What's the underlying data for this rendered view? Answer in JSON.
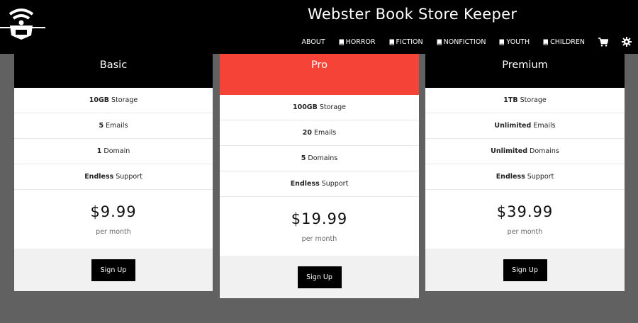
{
  "header": {
    "title": "Webster Book Store Keeper",
    "nav": [
      {
        "label": "ABOUT",
        "icon": ""
      },
      {
        "label": "HORROR",
        "icon": "book-icon"
      },
      {
        "label": "FICTION",
        "icon": "book-icon"
      },
      {
        "label": "NONFICTION",
        "icon": "book-icon"
      },
      {
        "label": "YOUTH",
        "icon": "book-icon"
      },
      {
        "label": "CHILDREN",
        "icon": "book-icon"
      }
    ],
    "icons": [
      "cart-icon",
      "gear-icon"
    ]
  },
  "plans": [
    {
      "name": "Basic",
      "features": [
        {
          "bold": "10GB",
          "text": "Storage"
        },
        {
          "bold": "5",
          "text": "Emails"
        },
        {
          "bold": "1",
          "text": "Domain"
        },
        {
          "bold": "Endless",
          "text": "Support"
        }
      ],
      "price": "$9.99",
      "period": "per month",
      "button": "Sign Up"
    },
    {
      "name": "Pro",
      "features": [
        {
          "bold": "100GB",
          "text": "Storage"
        },
        {
          "bold": "20",
          "text": "Emails"
        },
        {
          "bold": "5",
          "text": "Domains"
        },
        {
          "bold": "Endless",
          "text": "Support"
        }
      ],
      "price": "$19.99",
      "period": "per month",
      "button": "Sign Up"
    },
    {
      "name": "Premium",
      "features": [
        {
          "bold": "1TB",
          "text": "Storage"
        },
        {
          "bold": "Unlimited",
          "text": "Emails"
        },
        {
          "bold": "Unlimited",
          "text": "Domains"
        },
        {
          "bold": "Endless",
          "text": "Support"
        }
      ],
      "price": "$39.99",
      "period": "per month",
      "button": "Sign Up"
    }
  ],
  "colors": {
    "header_bg": "#000000",
    "highlight": "#f54337",
    "page_bg": "#616161"
  }
}
